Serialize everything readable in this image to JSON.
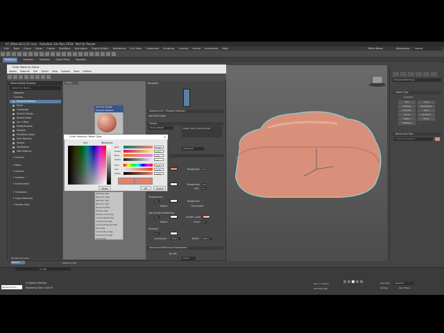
{
  "app": {
    "title": "07_Materials3_01.max - Autodesk 3ds Max 2018 - Not for Resale",
    "menu": [
      "Edit",
      "Tools",
      "Group",
      "Views",
      "Create",
      "Modifiers",
      "Animation",
      "Graph Editors",
      "Rendering",
      "Civil View",
      "Customize",
      "Scripting",
      "Content",
      "Arnold",
      "Interactive",
      "Help"
    ],
    "ribbon_tabs": [
      "Modeling",
      "Freeform",
      "Selection",
      "Object Paint",
      "Populate"
    ],
    "user": "Patrick Boone",
    "workspace_label": "Workspaces:",
    "workspace_value": "Default"
  },
  "sme": {
    "title": "Slate Material Editor",
    "menu": [
      "Modes",
      "Material",
      "Edit",
      "Select",
      "View",
      "Options",
      "Tools",
      "Utilities"
    ],
    "browser_header": "Material/Map Browser",
    "search_placeholder": "Search by Name ...",
    "categories": {
      "materials": "- Materials",
      "general": "- General",
      "scanline": "+ Scanline",
      "maps": "+ Maps",
      "general2": "+ General",
      "scanline2": "+ Scanline",
      "environment": "+ Environment",
      "controllers": "+ Controllers",
      "scene_materials": "+ Scene Materials",
      "sample_slots": "+ Sample Slots"
    },
    "materials": [
      "Physical Material",
      "Blend",
      "Composite",
      "DirectX Shader",
      "Double Sided",
      "Ink 'n Paint",
      "Matte/Shadow",
      "Morpher",
      "Multi/Sub-Object",
      "Shell Material",
      "Shellac",
      "Top/Bottom",
      "XRef Material"
    ],
    "view_tab": "View1",
    "navigator_label": "Navigator",
    "node_title": "mat top orange",
    "node_subtitle": "Physical Material",
    "node_maps": [
      "DIFF Base Map",
      "Base Color Map",
      "Reflection Map",
      "Refl Color Map",
      "Roughness Map",
      "Emission Map",
      "Emission Color Map",
      "Coating Weight Map",
      "Coating Color Map",
      "Coating Roughness Map",
      "Bump Map",
      "Coating Bump Map",
      "Displacement Map",
      "Cutout Map"
    ],
    "props": {
      "header": "Material #42 ( Physical Material )",
      "name": "mat top orange",
      "presets": "Presets",
      "preset_value": "Glossy Plastic",
      "preset_desc": "Plastic with a glossy finish",
      "material_mode_label": "Material mode:",
      "material_mode": "Advanced",
      "basic_params": "Basic Parameters",
      "roughness_label": "Roughness:",
      "roughness": "0.25",
      "ior_label": "IOR:",
      "ior": "1.5",
      "transparency": "Transparency",
      "thin_walled": "Thin-walled",
      "depth_label": "Depth:",
      "sss": "Sub-Surface Scattering",
      "scatter_color_label": "Scatter Color:",
      "scale_label": "Scale:",
      "scale": "1.0",
      "emission": "Emission",
      "luminance_label": "Luminance:",
      "luminance": "1500.0",
      "kelvin_label": "Kelvin:",
      "kelvin": "6500.0",
      "adv_refl": "Advanced Reflectance Parameters",
      "by_ior": "By IOR",
      "val_10": "1.0",
      "val_00": "0.0"
    },
    "zoom": "Zoom"
  },
  "color_selector": {
    "title": "Color Selector: Base Color",
    "hue_label": "Hue",
    "whiteness_label": "Whiteness",
    "channels": [
      {
        "label": "Red:",
        "value": "0.906"
      },
      {
        "label": "Green:",
        "value": "0.502"
      },
      {
        "label": "Blue:",
        "value": "0.42"
      },
      {
        "label": "Alpha:",
        "value": "1.0"
      },
      {
        "label": "Hue:",
        "value": "0.031"
      },
      {
        "label": "Sat:",
        "value": "0.536"
      },
      {
        "label": "Value:",
        "value": "0.906"
      }
    ],
    "reset": "Reset",
    "ok": "OK",
    "cancel": "Cancel"
  },
  "cmd_panel": {
    "dropdown": "Standard Primitives",
    "object_type": "Object Type",
    "autogrid": "AutoGrid",
    "buttons": [
      "Box",
      "Cone",
      "Sphere",
      "GeoSphere",
      "Cylinder",
      "Tube",
      "Torus",
      "Pyramid",
      "Teapot",
      "Plane",
      "TextPlus"
    ],
    "name_color": "Name and Color",
    "selected": "4 Objects Selected"
  },
  "status": {
    "layer": "Rendering Preset",
    "default": "Default",
    "selection_set": "Selection Set",
    "objects_selected": "4 Objects Selected",
    "render_time": "Rendering Time: 0:00:05",
    "frame": "0 / 100",
    "maxscript": "MAXScript Mi...",
    "auto_key": "Auto Key",
    "set_key": "Set Key",
    "selected": "Selected",
    "key_filters": "Key Filters...",
    "add_time_tag": "Add Time Tag",
    "grid": "Grid = 10.0cm"
  },
  "colors": {
    "accent": "#5b7fa8",
    "model": "#d9907a",
    "base_color": "#e7806b"
  }
}
